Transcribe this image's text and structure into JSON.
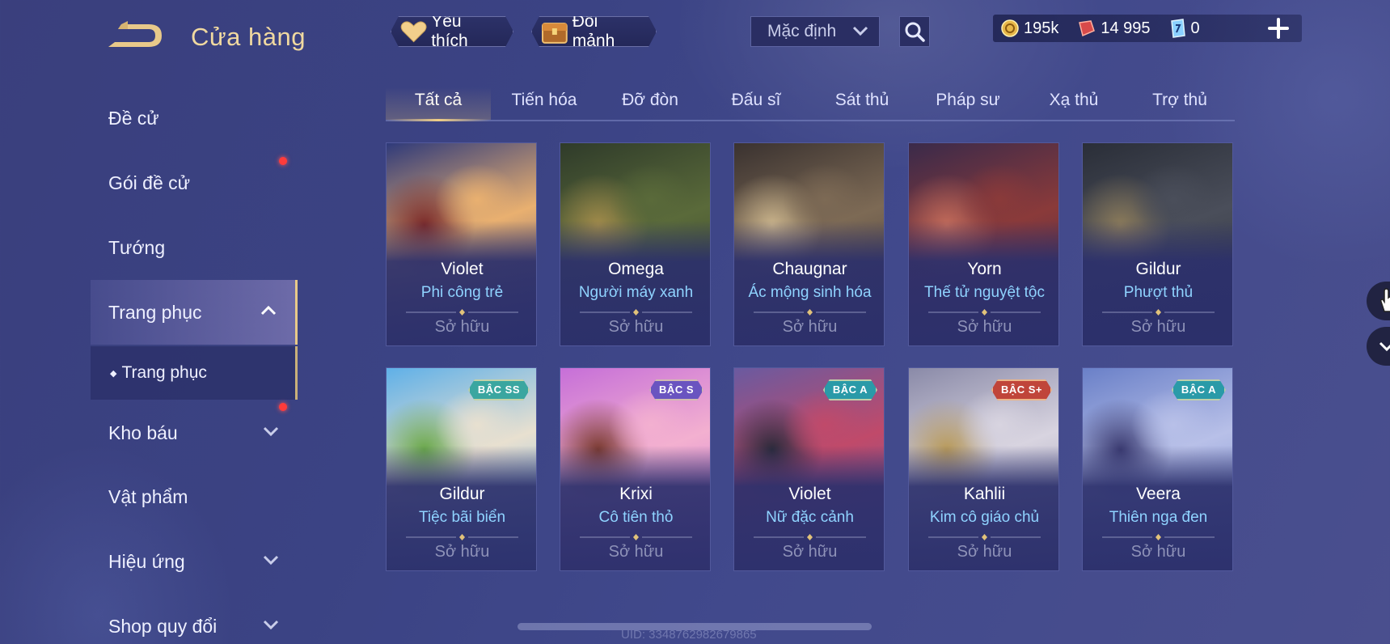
{
  "header": {
    "title": "Cửa hàng",
    "favorite_label": "Yêu thích",
    "exchange_label": "Đổi mảnh",
    "sort": {
      "selected": "Mặc định"
    },
    "currency": {
      "gold": "195k",
      "vouchers": "14 995",
      "coupons": "0"
    }
  },
  "sidebar": {
    "items": [
      {
        "label": "Đề cử",
        "dot": false
      },
      {
        "label": "Gói đề cử",
        "dot": true
      },
      {
        "label": "Tướng",
        "dot": false
      },
      {
        "label": "Trang phục",
        "dot": false,
        "expanded": true,
        "active": true
      },
      {
        "label": "Kho báu",
        "dot": true,
        "has_chevron": true
      },
      {
        "label": "Vật phẩm",
        "dot": false
      },
      {
        "label": "Hiệu ứng",
        "dot": false,
        "has_chevron": true
      },
      {
        "label": "Shop quy đổi",
        "dot": false,
        "has_chevron": true
      }
    ],
    "sub_item": "Trang phục"
  },
  "tabs": [
    "Tất cả",
    "Tiến hóa",
    "Đỡ đòn",
    "Đấu sĩ",
    "Sát thủ",
    "Pháp sư",
    "Xạ thủ",
    "Trợ thủ"
  ],
  "active_tab": "Tất cả",
  "cards": [
    {
      "hero": "Violet",
      "skin": "Phi công trẻ",
      "status": "Sở hữu",
      "tier": "",
      "colors": [
        "#2f3a7a",
        "#e9b070",
        "#7a2a2a"
      ]
    },
    {
      "hero": "Omega",
      "skin": "Người máy xanh",
      "status": "Sở hữu",
      "tier": "",
      "colors": [
        "#2f3b2a",
        "#5a6a3a",
        "#a08a4a"
      ]
    },
    {
      "hero": "Chaugnar",
      "skin": "Ác mộng sinh hóa",
      "status": "Sở hữu",
      "tier": "",
      "colors": [
        "#3a3230",
        "#7d6a55",
        "#c8b28a"
      ]
    },
    {
      "hero": "Yorn",
      "skin": "Thế tử nguyệt tộc",
      "status": "Sở hữu",
      "tier": "",
      "colors": [
        "#3a2a4a",
        "#8a3a3a",
        "#c06a5a"
      ]
    },
    {
      "hero": "Gildur",
      "skin": "Phượt thủ",
      "status": "Sở hữu",
      "tier": "",
      "colors": [
        "#2a2e38",
        "#4a4e5a",
        "#8a7a5a"
      ]
    },
    {
      "hero": "Gildur",
      "skin": "Tiệc bãi biển",
      "status": "Sở hữu",
      "tier": "BẬC SS",
      "tier_color": "#3aa6a0",
      "colors": [
        "#5fb0e8",
        "#e8e0d0",
        "#6aa84a"
      ]
    },
    {
      "hero": "Krixi",
      "skin": "Cô tiên thỏ",
      "status": "Sở hữu",
      "tier": "BẬC S",
      "tier_color": "#6a54c0",
      "colors": [
        "#c66fd8",
        "#f3b0d0",
        "#7a3a30"
      ]
    },
    {
      "hero": "Violet",
      "skin": "Nữ đặc cảnh",
      "status": "Sở hữu",
      "tier": "BẬC A",
      "tier_color": "#2a9aa8",
      "colors": [
        "#6a5aa0",
        "#c04a6a",
        "#2a2a3a"
      ]
    },
    {
      "hero": "Kahlii",
      "skin": "Kim cô giáo chủ",
      "status": "Sở hữu",
      "tier": "BẬC S+",
      "tier_color": "#c0453a",
      "colors": [
        "#8a8aa8",
        "#d8d4e0",
        "#b89a5a"
      ]
    },
    {
      "hero": "Veera",
      "skin": "Thiên nga đen",
      "status": "Sở hữu",
      "tier": "BẬC A",
      "tier_color": "#2a9aa8",
      "colors": [
        "#6a80c8",
        "#b8c0e8",
        "#3a3a70"
      ]
    }
  ],
  "footer": {
    "uid": "UID: 3348762982679865"
  },
  "colors": {
    "accent_gold": "#f0d9a0",
    "skin_blue": "#8fd3ff",
    "owned_gray": "#8e92b8",
    "red_dot": "#ff3b3b"
  }
}
